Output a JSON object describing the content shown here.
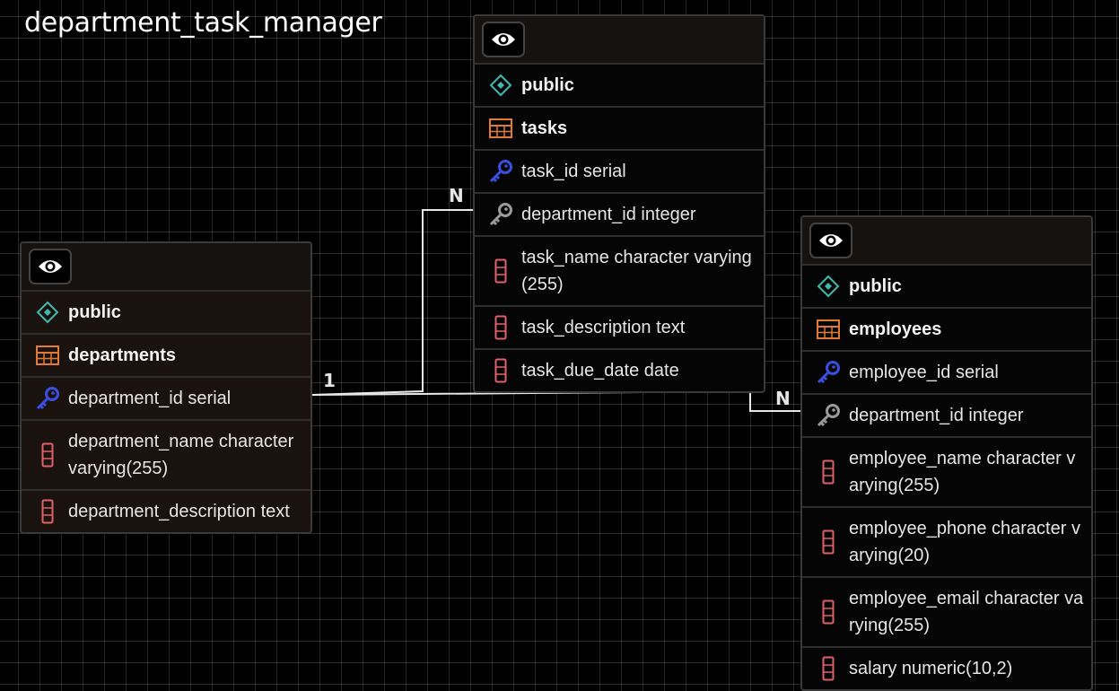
{
  "diagram_title": "department_task_manager",
  "tables": {
    "departments": {
      "schema": "public",
      "name": "departments",
      "columns": [
        {
          "text": "department_id serial",
          "kind": "pk"
        },
        {
          "text": "department_name character varying(255)",
          "kind": "col"
        },
        {
          "text": "department_description text",
          "kind": "col"
        }
      ]
    },
    "tasks": {
      "schema": "public",
      "name": "tasks",
      "columns": [
        {
          "text": "task_id serial",
          "kind": "pk"
        },
        {
          "text": "department_id integer",
          "kind": "fk"
        },
        {
          "text": "task_name character varying(255)",
          "kind": "col"
        },
        {
          "text": "task_description text",
          "kind": "col"
        },
        {
          "text": "task_due_date date",
          "kind": "col"
        }
      ]
    },
    "employees": {
      "schema": "public",
      "name": "employees",
      "columns": [
        {
          "text": "employee_id serial",
          "kind": "pk"
        },
        {
          "text": "department_id integer",
          "kind": "fk"
        },
        {
          "text": "employee_name character varying(255)",
          "kind": "col"
        },
        {
          "text": "employee_phone character varying(20)",
          "kind": "col"
        },
        {
          "text": "employee_email character varying(255)",
          "kind": "col"
        },
        {
          "text": "salary numeric(10,2)",
          "kind": "col"
        }
      ]
    }
  },
  "relations": {
    "departments_tasks": {
      "from_card": "1",
      "to_card": "N"
    },
    "departments_employees": {
      "to_card": "N"
    }
  },
  "colors": {
    "pk_key": "#3a4fe0",
    "fk_key": "#9a9a9a",
    "schema_icon": "#3fb9b0",
    "table_icon": "#e07a35",
    "column_icon": "#e0606a"
  }
}
